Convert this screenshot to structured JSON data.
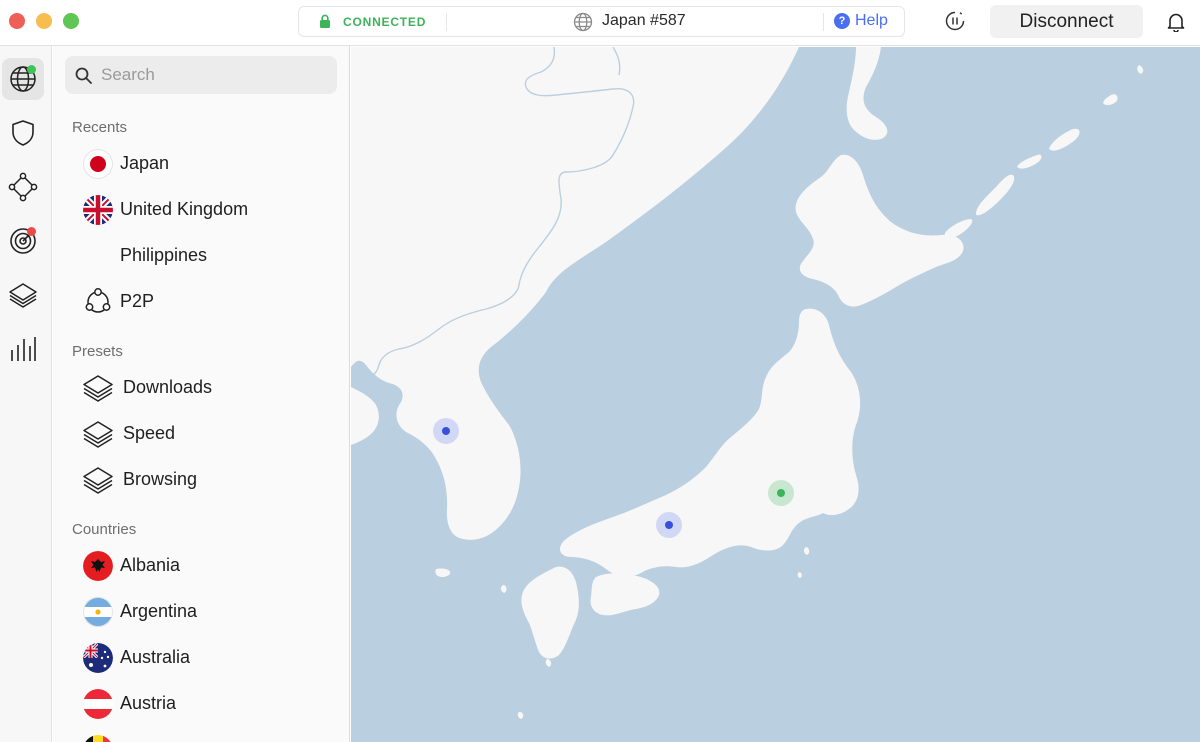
{
  "titlebar": {
    "status": "CONNECTED",
    "server": "Japan #587",
    "help": "Help",
    "disconnect": "Disconnect"
  },
  "rail": {
    "items": [
      "globe-icon",
      "shield-icon",
      "meshnet-icon",
      "radar-icon",
      "layers-icon",
      "stats-icon"
    ]
  },
  "sidebar": {
    "search_placeholder": "Search",
    "recents_title": "Recents",
    "recents": [
      {
        "label": "Japan"
      },
      {
        "label": "United Kingdom"
      },
      {
        "label": "Philippines"
      },
      {
        "label": "P2P"
      }
    ],
    "presets_title": "Presets",
    "presets": [
      {
        "label": "Downloads"
      },
      {
        "label": "Speed"
      },
      {
        "label": "Browsing"
      }
    ],
    "countries_title": "Countries",
    "countries": [
      {
        "label": "Albania"
      },
      {
        "label": "Argentina"
      },
      {
        "label": "Australia"
      },
      {
        "label": "Austria"
      }
    ]
  },
  "colors": {
    "connected": "#3cb45a",
    "accent": "#4a6ef2",
    "map_water": "#bacfe0",
    "map_land": "#f7f7f7"
  }
}
